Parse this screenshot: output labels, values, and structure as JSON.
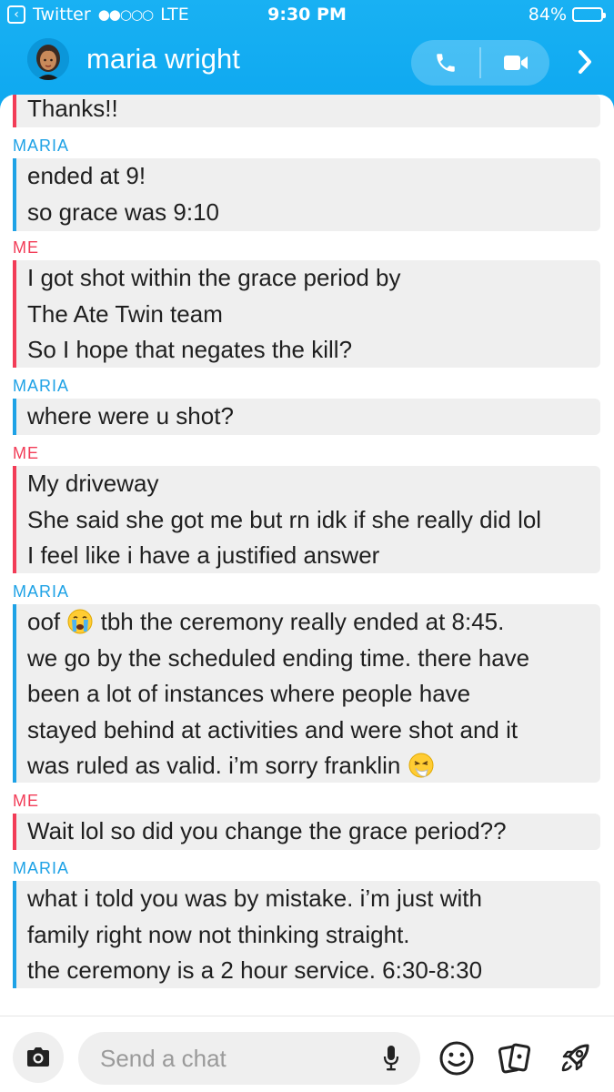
{
  "status_bar": {
    "back_app": "Twitter",
    "signal": "●●○○○",
    "carrier": "LTE",
    "time": "9:30 PM",
    "battery": "84%",
    "battery_level": 0.84
  },
  "header": {
    "contact_name": "maria wright",
    "icons": [
      "avatar",
      "phone-icon",
      "video-icon",
      "chevron-right-icon"
    ]
  },
  "messages": [
    {
      "sender": "",
      "who": "me",
      "lines": [
        "Thanks!!"
      ]
    },
    {
      "sender": "MARIA",
      "who": "maria",
      "lines": [
        "ended at 9!",
        "so grace was 9:10"
      ]
    },
    {
      "sender": "ME",
      "who": "me",
      "lines": [
        "I got shot within the grace period by",
        "The Ate Twin team",
        "So I hope that negates the kill?"
      ]
    },
    {
      "sender": "MARIA",
      "who": "maria",
      "lines": [
        "where were u shot?"
      ]
    },
    {
      "sender": "ME",
      "who": "me",
      "lines": [
        "My driveway",
        "She said she got me but rn idk if she really did lol",
        "I feel like i have a justified answer"
      ]
    },
    {
      "sender": "MARIA",
      "who": "maria",
      "lines": [
        "oof",
        "tbh the ceremony really ended at 8:45.",
        "we go by the scheduled ending time. there have",
        "been a lot of instances where people have",
        "stayed behind at activities and were shot and it",
        "was ruled as valid. i’m sorry franklin"
      ]
    },
    {
      "sender": "ME",
      "who": "me",
      "lines": [
        "Wait lol so did you change the grace period??"
      ]
    },
    {
      "sender": "MARIA",
      "who": "maria",
      "lines": [
        "what i told you was by mistake. i’m just with",
        "family right now not thinking straight.",
        "the ceremony is a 2 hour service. 6:30-8:30"
      ]
    }
  ],
  "composer": {
    "placeholder": "Send a chat",
    "icons": [
      "camera-icon",
      "mic-icon",
      "smiley-icon",
      "cards-icon",
      "rocket-icon"
    ]
  },
  "colors": {
    "header_blue": "#0ea8f0",
    "maria_blue": "#1ea2e6",
    "me_red": "#f23c57",
    "bubble_gray": "#efefef"
  }
}
